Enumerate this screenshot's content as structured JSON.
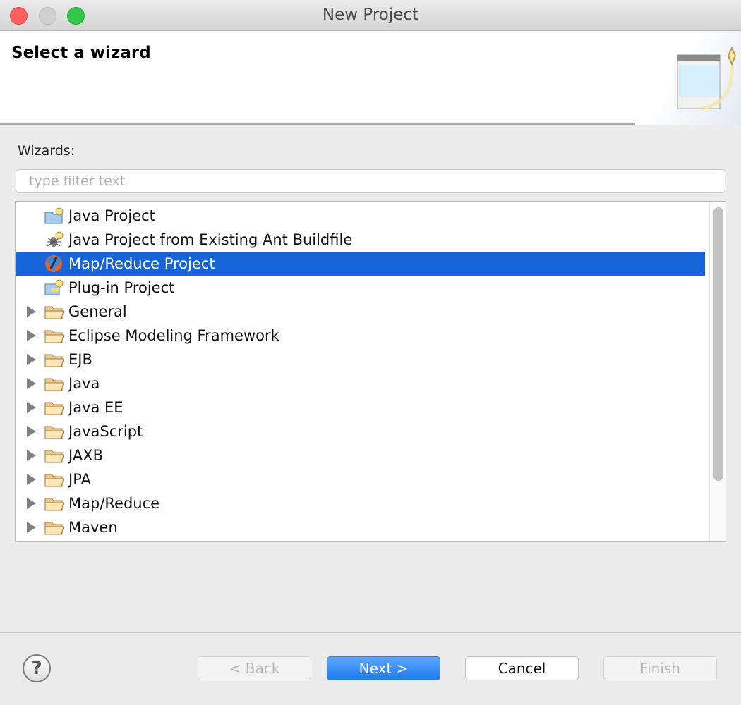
{
  "window": {
    "title": "New Project"
  },
  "header": {
    "title": "Select a wizard"
  },
  "wizards_label": "Wizards:",
  "filter": {
    "placeholder": "type filter text",
    "value": ""
  },
  "tree": {
    "items": [
      {
        "label": "Java Project",
        "icon": "java-project-icon",
        "expandable": false
      },
      {
        "label": "Java Project from Existing Ant Buildfile",
        "icon": "ant-icon",
        "expandable": false
      },
      {
        "label": "Map/Reduce Project",
        "icon": "mapreduce-icon",
        "expandable": false,
        "selected": true
      },
      {
        "label": "Plug-in Project",
        "icon": "plugin-project-icon",
        "expandable": false
      },
      {
        "label": "General",
        "icon": "folder-icon",
        "expandable": true
      },
      {
        "label": "Eclipse Modeling Framework",
        "icon": "folder-icon",
        "expandable": true
      },
      {
        "label": "EJB",
        "icon": "folder-icon",
        "expandable": true
      },
      {
        "label": "Java",
        "icon": "folder-icon",
        "expandable": true
      },
      {
        "label": "Java EE",
        "icon": "folder-icon",
        "expandable": true
      },
      {
        "label": "JavaScript",
        "icon": "folder-icon",
        "expandable": true
      },
      {
        "label": "JAXB",
        "icon": "folder-icon",
        "expandable": true
      },
      {
        "label": "JPA",
        "icon": "folder-icon",
        "expandable": true
      },
      {
        "label": "Map/Reduce",
        "icon": "folder-icon",
        "expandable": true
      },
      {
        "label": "Maven",
        "icon": "folder-icon",
        "expandable": true
      }
    ]
  },
  "buttons": {
    "help": "?",
    "back": "< Back",
    "next": "Next >",
    "cancel": "Cancel",
    "finish": "Finish"
  },
  "colors": {
    "selection": "#1565d8",
    "default_button": "#1f79f0"
  }
}
